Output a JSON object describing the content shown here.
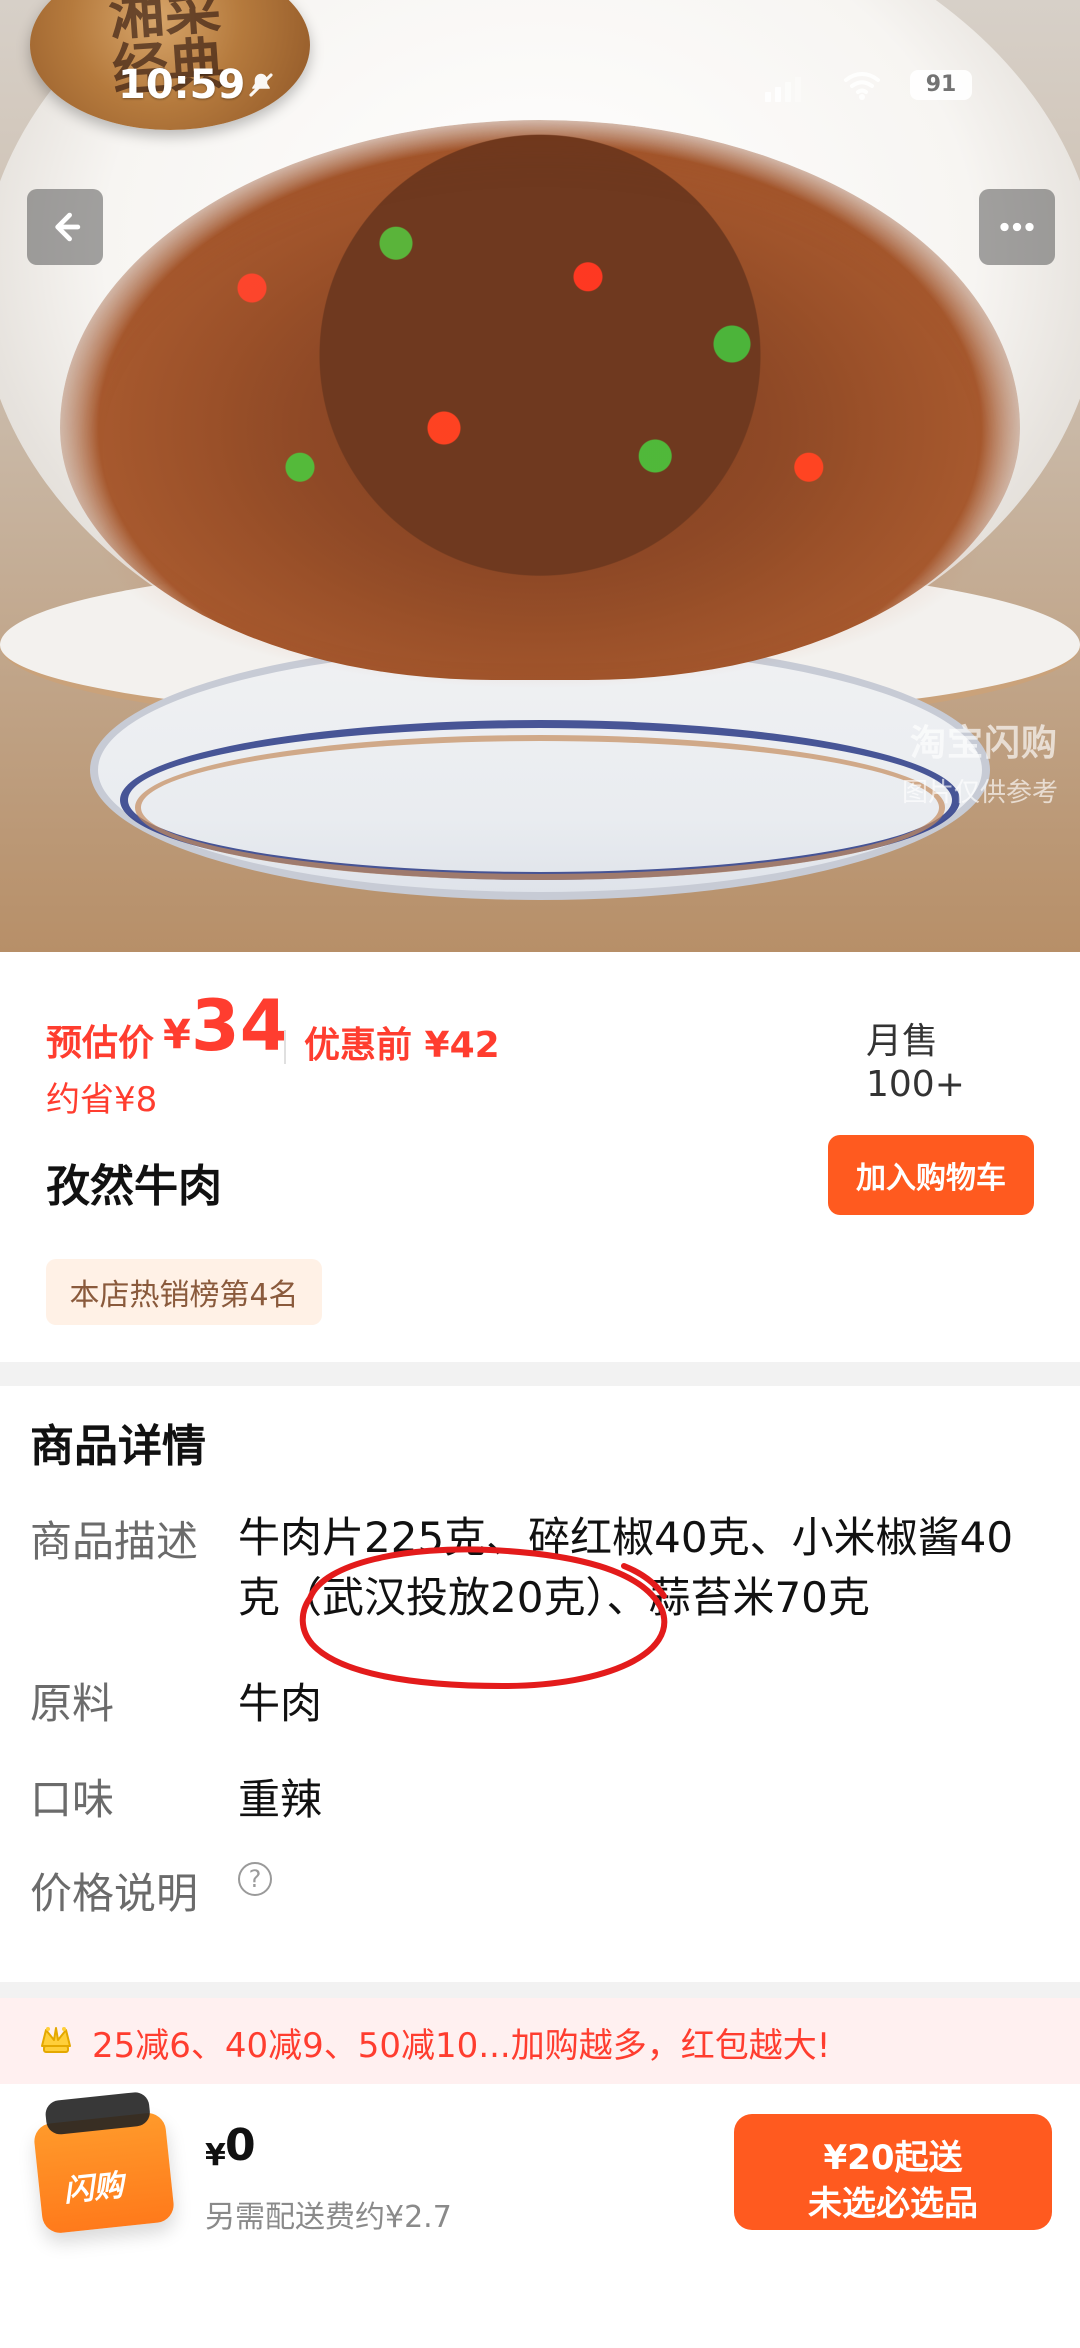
{
  "status": {
    "time": "10:59",
    "battery": "91"
  },
  "hero": {
    "badge_text": "湘菜\n经典",
    "watermark_title": "淘宝闪购",
    "watermark_subtitle": "图片仅供参考",
    "icons": {
      "back": "back-arrow-icon",
      "more": "more-dots-icon"
    }
  },
  "price": {
    "est_label": "预估价",
    "yen_symbol": "¥",
    "estimated": "34",
    "before_label": "优惠前 ¥42",
    "save_text": "约省¥8",
    "monthly_sales": "月售 100+"
  },
  "product": {
    "name": "孜然牛肉",
    "add_to_cart": "加入购物车",
    "rank_tag": "本店热销榜第4名"
  },
  "details": {
    "title": "商品详情",
    "rows": [
      {
        "label": "商品描述",
        "value": "牛肉片225克、碎红椒40克、小米椒酱40克（武汉投放20克）、蒜苔米70克"
      },
      {
        "label": "原料",
        "value": "牛肉"
      },
      {
        "label": "口味",
        "value": "重辣"
      },
      {
        "label": "价格说明",
        "value": ""
      }
    ],
    "price_info_icon": "help-circle-icon"
  },
  "promo": {
    "icon": "crown-icon",
    "text": "25减6、40减9、50减10...加购越多，红包越大!"
  },
  "bottom": {
    "bag_label": "闪购",
    "cart_yen": "¥",
    "cart_total": "0",
    "delivery_fee": "另需配送费约¥2.7",
    "checkout_line1": "¥20起送",
    "checkout_line2": "未选必选品"
  },
  "colors": {
    "accent_red": "#ff3d2f",
    "accent_orange": "#ff5a1f",
    "rank_tag_bg": "#fff1e6",
    "promo_bg": "#fff0f0"
  }
}
